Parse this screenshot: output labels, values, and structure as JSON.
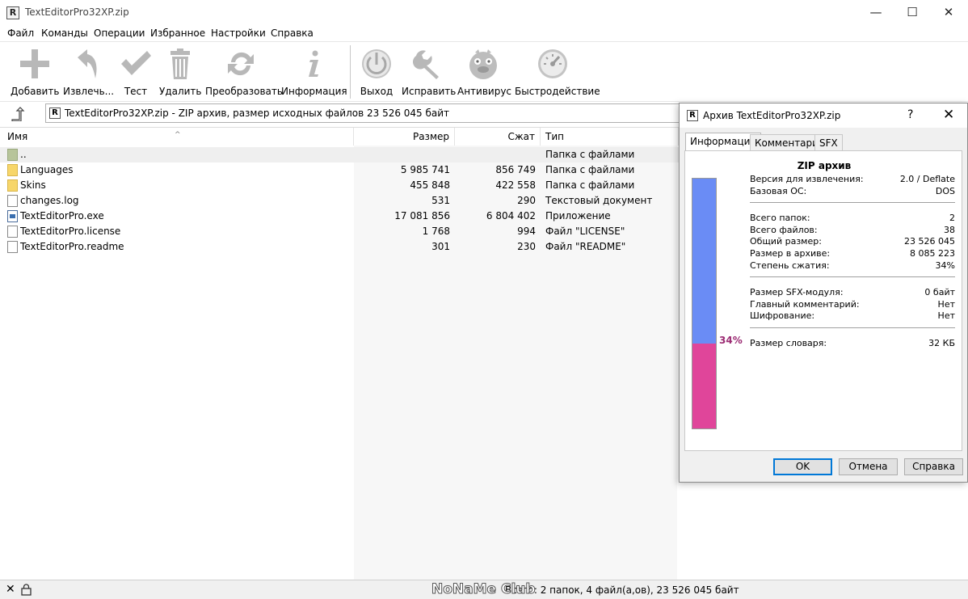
{
  "window": {
    "title": "TextEditorPro32XP.zip",
    "app_icon": "R",
    "buttons": [
      "—",
      "☐",
      "✕"
    ]
  },
  "menu": [
    "Файл",
    "Команды",
    "Операции",
    "Избранное",
    "Настройки",
    "Справка"
  ],
  "toolbar": {
    "buttons": [
      {
        "label": "Добавить",
        "icon": "plus-icon"
      },
      {
        "label": "Извлечь...",
        "icon": "extract-arrow-icon"
      },
      {
        "label": "Тест",
        "icon": "checkmark-icon"
      },
      {
        "label": "Удалить",
        "icon": "trash-icon"
      },
      {
        "label": "Преобразовать",
        "icon": "convert-icon"
      },
      {
        "label": "Информация",
        "icon": "info-icon"
      },
      {
        "label": "Выход",
        "icon": "power-icon"
      },
      {
        "label": "Исправить",
        "icon": "wrench-icon"
      },
      {
        "label": "Антивирус",
        "icon": "antivirus-icon"
      },
      {
        "label": "Быстродействие",
        "icon": "speedometer-icon"
      }
    ]
  },
  "address": {
    "text": "TextEditorPro32XP.zip - ZIP архив, размер исходных файлов 23 526 045 байт",
    "icon": "R"
  },
  "columns": {
    "name": "Имя",
    "size": "Размер",
    "packed": "Сжат",
    "type": "Тип"
  },
  "files": [
    {
      "name": "..",
      "size": "",
      "packed": "",
      "type": "Папка с файлами",
      "icon": "folder-up-icon"
    },
    {
      "name": "Languages",
      "size": "5 985 741",
      "packed": "856 749",
      "type": "Папка с файлами",
      "icon": "folder-icon"
    },
    {
      "name": "Skins",
      "size": "455 848",
      "packed": "422 558",
      "type": "Папка с файлами",
      "icon": "folder-icon"
    },
    {
      "name": "changes.log",
      "size": "531",
      "packed": "290",
      "type": "Текстовый документ",
      "icon": "text-file-icon"
    },
    {
      "name": "TextEditorPro.exe",
      "size": "17 081 856",
      "packed": "6 804 402",
      "type": "Приложение",
      "icon": "exe-file-icon"
    },
    {
      "name": "TextEditorPro.license",
      "size": "1 768",
      "packed": "994",
      "type": "Файл \"LICENSE\"",
      "icon": "file-icon"
    },
    {
      "name": "TextEditorPro.readme",
      "size": "301",
      "packed": "230",
      "type": "Файл \"README\"",
      "icon": "file-icon"
    }
  ],
  "status": {
    "text": "Всего: 2 папок, 4 файл(а,ов), 23 526 045 байт",
    "watermark": "NoNaMe Club"
  },
  "dialog": {
    "title": "Архив TextEditorPro32XP.zip",
    "help": "?",
    "close": "✕",
    "tabs": [
      "Информация",
      "Комментарий",
      "SFX"
    ],
    "panel_title": "ZIP архив",
    "ratio_label": "34%",
    "ratio_fraction": 0.34,
    "colors": {
      "bar_top": "#6a8cf5",
      "bar_bottom": "#e0459a"
    },
    "groups": [
      [
        {
          "k": "Версия для извлечения:",
          "v": "2.0 / Deflate"
        },
        {
          "k": "Базовая ОС:",
          "v": "DOS"
        }
      ],
      [
        {
          "k": "Всего папок:",
          "v": "2"
        },
        {
          "k": "Всего файлов:",
          "v": "38"
        },
        {
          "k": "Общий размер:",
          "v": "23 526 045"
        },
        {
          "k": "Размер в архиве:",
          "v": "8 085 223"
        },
        {
          "k": "Степень сжатия:",
          "v": "34%"
        }
      ],
      [
        {
          "k": "Размер SFX-модуля:",
          "v": "0 байт"
        },
        {
          "k": "Главный комментарий:",
          "v": "Нет"
        },
        {
          "k": "Шифрование:",
          "v": "Нет"
        }
      ],
      [
        {
          "k": "Размер словаря:",
          "v": "32 КБ"
        }
      ]
    ],
    "buttons": {
      "ok": "OK",
      "cancel": "Отмена",
      "help": "Справка"
    }
  }
}
